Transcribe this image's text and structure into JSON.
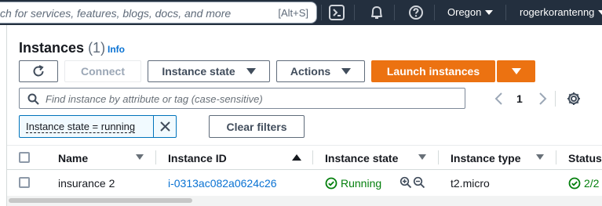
{
  "topnav": {
    "search_placeholder": "ch for services, features, blogs, docs, and more",
    "search_shortcut": "[Alt+S]",
    "region": "Oregon",
    "user": "rogerkorantenng"
  },
  "header": {
    "title": "Instances",
    "count": "(1)",
    "info": "Info"
  },
  "toolbar": {
    "connect_label": "Connect",
    "instance_state_label": "Instance state",
    "actions_label": "Actions",
    "launch_label": "Launch instances"
  },
  "filter": {
    "placeholder": "Find instance by attribute or tag (case-sensitive)",
    "page": "1",
    "token": "Instance state = running",
    "clear_label": "Clear filters"
  },
  "table": {
    "columns": [
      "Name",
      "Instance ID",
      "Instance state",
      "Instance type",
      "Status"
    ],
    "rows": [
      {
        "name": "insurance 2",
        "instance_id": "i-0313ac082a0624c26",
        "state": "Running",
        "type": "t2.micro",
        "status": "2/2"
      }
    ]
  },
  "colors": {
    "nav_bg": "#232f3e",
    "primary": "#ec7211",
    "link": "#0972d3",
    "success": "#037f0c"
  }
}
